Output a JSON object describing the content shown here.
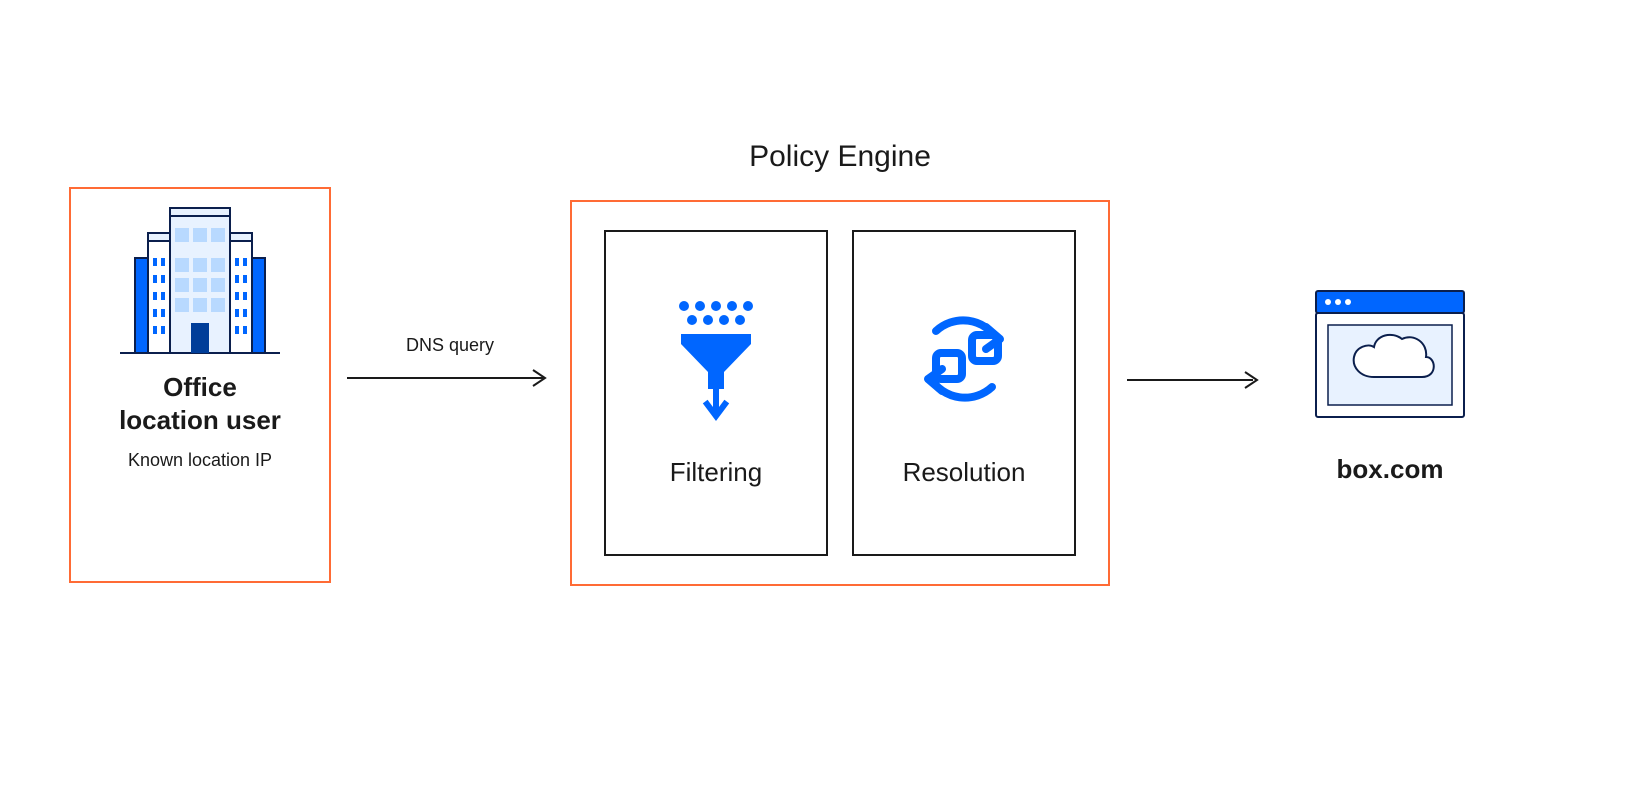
{
  "colors": {
    "accent_orange": "#ff6b35",
    "accent_blue": "#0066ff",
    "deep_blue": "#003e99",
    "light_blue": "#e8f2ff",
    "ink": "#1a1a1a"
  },
  "user_box": {
    "title_line1": "Office",
    "title_line2": "location user",
    "subtitle": "Known location IP",
    "icon": "office-building-icon"
  },
  "arrow1": {
    "label": "DNS query"
  },
  "policy_engine": {
    "title": "Policy Engine",
    "filtering": {
      "label": "Filtering",
      "icon": "funnel-icon"
    },
    "resolution": {
      "label": "Resolution",
      "icon": "cycle-icon"
    }
  },
  "arrow2": {
    "label": ""
  },
  "destination": {
    "label": "box.com",
    "icon": "browser-cloud-icon"
  }
}
